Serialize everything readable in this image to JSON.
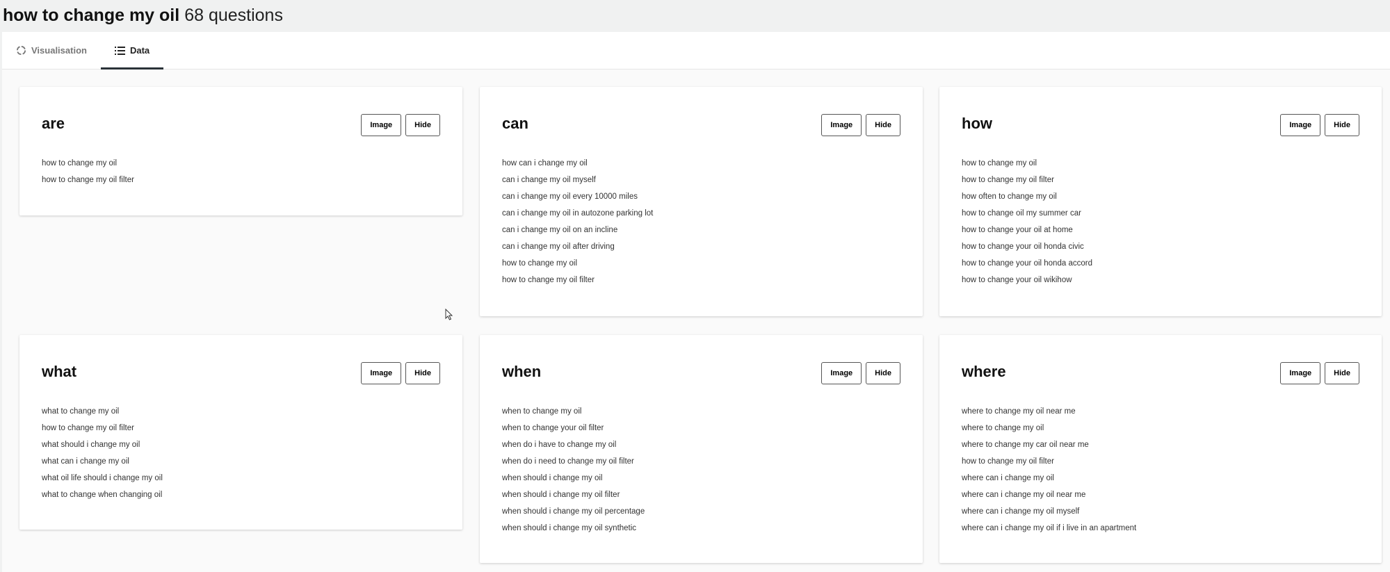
{
  "header": {
    "query": "how to change my oil",
    "count": "68 questions"
  },
  "tabs": [
    {
      "label": "Visualisation",
      "icon": "spinner-icon"
    },
    {
      "label": "Data",
      "icon": "list-icon"
    }
  ],
  "buttons": {
    "image": "Image",
    "hide": "Hide"
  },
  "cards": [
    {
      "title": "are",
      "items": [
        "how to change my oil",
        "how to change my oil filter"
      ]
    },
    {
      "title": "can",
      "items": [
        "how can i change my oil",
        "can i change my oil myself",
        "can i change my oil every 10000 miles",
        "can i change my oil in autozone parking lot",
        "can i change my oil on an incline",
        "can i change my oil after driving",
        "how to change my oil",
        "how to change my oil filter"
      ]
    },
    {
      "title": "how",
      "items": [
        "how to change my oil",
        "how to change my oil filter",
        "how often to change my oil",
        "how to change oil my summer car",
        "how to change your oil at home",
        "how to change your oil honda civic",
        "how to change your oil honda accord",
        "how to change your oil wikihow"
      ]
    },
    {
      "title": "what",
      "items": [
        "what to change my oil",
        "how to change my oil filter",
        "what should i change my oil",
        "what can i change my oil",
        "what oil life should i change my oil",
        "what to change when changing oil"
      ]
    },
    {
      "title": "when",
      "items": [
        "when to change my oil",
        "when to change your oil filter",
        "when do i have to change my oil",
        "when do i need to change my oil filter",
        "when should i change my oil",
        "when should i change my oil filter",
        "when should i change my oil percentage",
        "when should i change my oil synthetic"
      ]
    },
    {
      "title": "where",
      "items": [
        "where to change my oil near me",
        "where to change my oil",
        "where to change my car oil near me",
        "how to change my oil filter",
        "where can i change my oil",
        "where can i change my oil near me",
        "where can i change my oil myself",
        "where can i change my oil if i live in an apartment"
      ]
    }
  ]
}
